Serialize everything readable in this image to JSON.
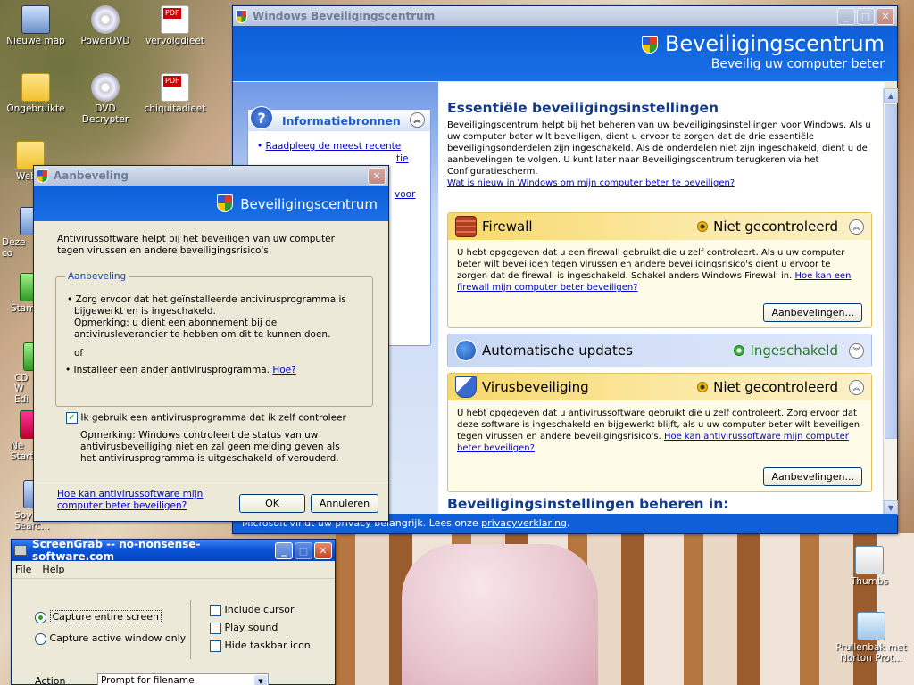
{
  "desktop": {
    "icons": [
      {
        "label": "Nieuwe map",
        "icon": "photo-folder-icon"
      },
      {
        "label": "PowerDVD",
        "icon": "dvd-player-icon"
      },
      {
        "label": "vervolgdieet",
        "icon": "pdf-file-icon"
      },
      {
        "label": "Ongebruikte",
        "icon": "folder-icon"
      },
      {
        "label": "DVD Decrypter",
        "icon": "dvd-disc-icon"
      },
      {
        "label": "chiquitadieet",
        "icon": "pdf-file-icon"
      },
      {
        "label": "Web",
        "icon": "folder-icon"
      },
      {
        "label": "Deze co",
        "icon": "my-computer-icon"
      },
      {
        "label": "Stam",
        "icon": "shortcut-icon"
      },
      {
        "label": "CD W",
        "icon": "shortcut-icon"
      },
      {
        "label": "Edi",
        "icon": "shortcut-icon"
      },
      {
        "label": "Ne",
        "icon": "shortcut-icon"
      },
      {
        "label": "Start",
        "icon": "shortcut-icon"
      },
      {
        "label": "Spyl",
        "icon": "shortcut-icon"
      },
      {
        "label": "Searc...",
        "icon": "shortcut-icon"
      },
      {
        "label": "Thumbs",
        "icon": "thumbs-file-icon"
      },
      {
        "label": "Prullenbak met Norton Prot...",
        "icon": "recycle-bin-icon"
      }
    ]
  },
  "security_center": {
    "window_title": "Windows Beveiligingscentrum",
    "header_title": "Beveiligingscentrum",
    "header_subtitle": "Beveilig uw computer beter",
    "info": {
      "title": "Informatiebronnen",
      "link_line1": "Raadpleeg de meest recente",
      "link_line2_fragment": "tie",
      "link_line3_fragment": "voor"
    },
    "main_title": "Essentiële beveiligingsinstellingen",
    "intro": "Beveiligingscentrum helpt bij het beheren van uw beveiligingsinstellingen voor Windows. Als u uw computer beter wilt beveiligen, dient u ervoor te zorgen dat de drie essentiële beveiligingsonderdelen zijn ingeschakeld. Als de onderdelen niet zijn ingeschakeld, dient u de aanbevelingen te volgen. U kunt later naar Beveiligingscentrum terugkeren via het Configuratiescherm.",
    "intro_link": "Wat is nieuw in Windows om mijn computer beter te beveiligen?",
    "firewall": {
      "name": "Firewall",
      "status": "Niet gecontroleerd",
      "text": "U hebt opgegeven dat u een firewall gebruikt die u zelf controleert. Als u uw computer beter wilt beveiligen tegen virussen en andere beveiligingsrisico's dient u ervoor te zorgen dat de firewall is ingeschakeld. Schakel anders Windows Firewall in.",
      "link": "Hoe kan een firewall mijn computer beter beveiligen?",
      "button": "Aanbevelingen..."
    },
    "updates": {
      "name": "Automatische updates",
      "status": "Ingeschakeld"
    },
    "virus": {
      "name": "Virusbeveiliging",
      "status": "Niet gecontroleerd",
      "text": "U hebt opgegeven dat u antivirussoftware gebruikt die u zelf controleert. Zorg ervoor dat deze software is ingeschakeld en bijgewerkt blijft, als u uw computer beter wilt beveiligen tegen virussen en andere beveiligingsrisico's.",
      "link": "Hoe kan antivirussoftware mijn computer beter beveiligen?",
      "button": "Aanbevelingen..."
    },
    "manage_title": "Beveiligingsinstellingen beheren in:",
    "status_text": "Microsoft vindt uw privacy belangrijk. Lees onze",
    "status_link": "privacyverklaring",
    "status_suffix": "."
  },
  "aanbeveling": {
    "window_title": "Aanbeveling",
    "banner": "Beveiligingscentrum",
    "intro": "Antivirussoftware helpt bij het beveiligen van uw computer tegen virussen en andere beveiligingsrisico's.",
    "group_label": "Aanbeveling",
    "bullet1": "Zorg ervoor dat het geïnstalleerde antivirusprogramma is bijgewerkt en is ingeschakeld.",
    "note1": "Opmerking: u dient een abonnement bij de antivirusleverancier te hebben om dit te kunnen doen.",
    "or": "of",
    "bullet2": "Installeer een ander antivirusprogramma.",
    "bullet2_link": "Hoe?",
    "checkbox_label": "Ik gebruik een antivirusprogramma dat ik zelf controleer",
    "checkbox_checked": true,
    "note2": "Opmerking: Windows controleert de status van uw antivirusbeveiliging niet en zal geen melding geven als het antivirusprogramma is uitgeschakeld of verouderd.",
    "help_link": "Hoe kan antivirussoftware mijn computer beter beveiligen?",
    "ok": "OK",
    "cancel": "Annuleren"
  },
  "screengrab": {
    "window_title": "ScreenGrab  --  no-nonsense-software.com",
    "menu": [
      "File",
      "Help"
    ],
    "radio_entire": "Capture entire screen",
    "radio_window": "Capture active window only",
    "check_cursor": "Include cursor",
    "check_sound": "Play sound",
    "check_taskbar": "Hide taskbar icon",
    "action_label": "Action",
    "action_value": "Prompt for filename"
  }
}
